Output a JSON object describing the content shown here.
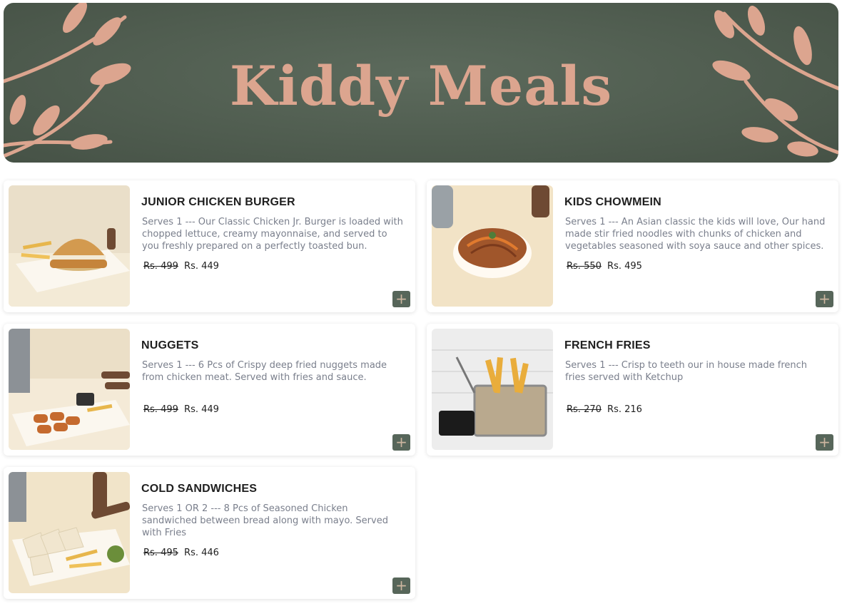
{
  "banner": {
    "title": "Kiddy Meals"
  },
  "colors": {
    "banner_bg": "#4f5c4f",
    "leaf": "#dca58f",
    "add_button": "#57665a"
  },
  "items": [
    {
      "name": "JUNIOR CHICKEN BURGER",
      "description": "Serves 1 --- Our Classic Chicken Jr. Burger is loaded with chopped lettuce, creamy mayonnaise, and served to you freshly prepared on a perfectly toasted bun.",
      "old_price": "Rs. 499",
      "price": "Rs. 449",
      "add_icon": "plus-icon"
    },
    {
      "name": "KIDS CHOWMEIN",
      "description": "Serves 1 --- An Asian classic the kids will love, Our hand made stir fried noodles with chunks of chicken and vegetables seasoned with soya sauce and other spices.",
      "old_price": "Rs. 550",
      "price": "Rs. 495",
      "add_icon": "plus-icon"
    },
    {
      "name": "NUGGETS",
      "description": "Serves 1 --- 6 Pcs of Crispy deep fried nuggets made from chicken meat. Served with fries and sauce.",
      "old_price": "Rs. 499",
      "price": "Rs. 449",
      "add_icon": "plus-icon"
    },
    {
      "name": "FRENCH FRIES",
      "description": "Serves 1 --- Crisp to teeth our in house made french fries served with Ketchup",
      "old_price": "Rs. 270",
      "price": "Rs. 216",
      "add_icon": "plus-icon"
    },
    {
      "name": "COLD SANDWICHES",
      "description": "Serves 1 OR 2 --- 8 Pcs of Seasoned Chicken sandwiched between bread along with mayo. Served with Fries",
      "old_price": "Rs. 495",
      "price": "Rs. 446",
      "add_icon": "plus-icon"
    }
  ]
}
